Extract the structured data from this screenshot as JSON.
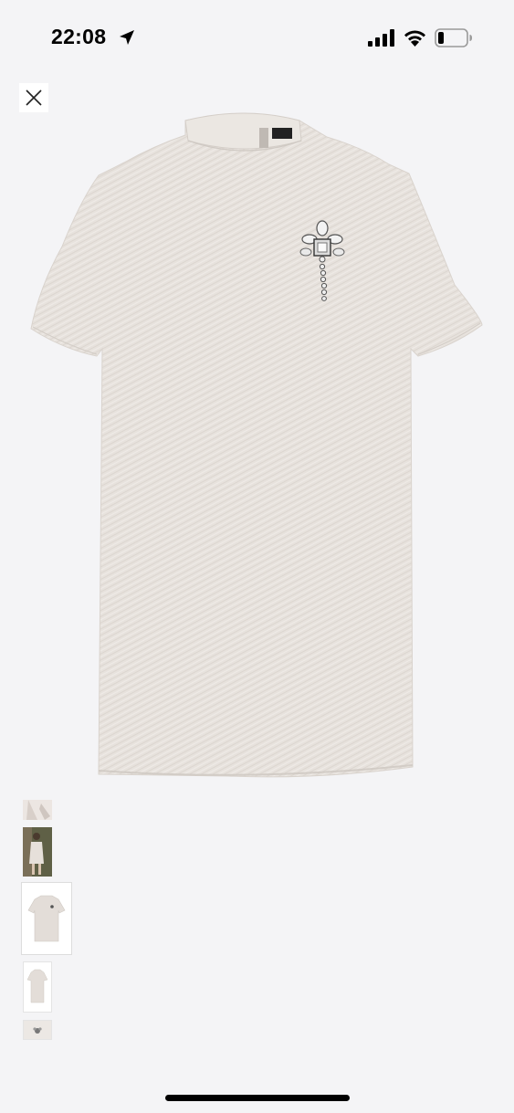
{
  "status_bar": {
    "time": "22:08",
    "icons": [
      "location-arrow-icon",
      "cellular-signal-icon",
      "wifi-icon",
      "battery-icon"
    ]
  },
  "close_icon": "close-icon",
  "product_image": {
    "subject": "dress",
    "thumbnail_count": 5,
    "selected_thumbnail": 3
  },
  "colors": {
    "background": "#f4f4f6",
    "fabric": "#e8e3de",
    "home_indicator": "#000000"
  }
}
